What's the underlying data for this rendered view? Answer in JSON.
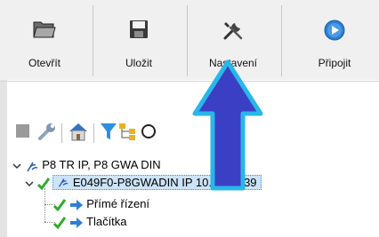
{
  "toolbar": {
    "open_label": "Otevřít",
    "save_label": "Uložit",
    "settings_label": "Nastavení",
    "connect_label": "Připojit"
  },
  "tree": {
    "root": "P8 TR IP, P8 GWA DIN",
    "device": "E049F0-P8GWADIN IP 10.16.2.139",
    "children": [
      "Přímé řízení",
      "Tlačítka"
    ]
  },
  "icons": {
    "open": "folder-open-icon",
    "save": "floppy-disk-icon",
    "settings": "tools-icon",
    "connect": "play-circle-icon"
  },
  "colors": {
    "accent_blue": "#2d7fd6",
    "arrow_fill": "#3b3fc4",
    "arrow_outline": "#28b7e8",
    "check_green": "#2eaa2e"
  }
}
